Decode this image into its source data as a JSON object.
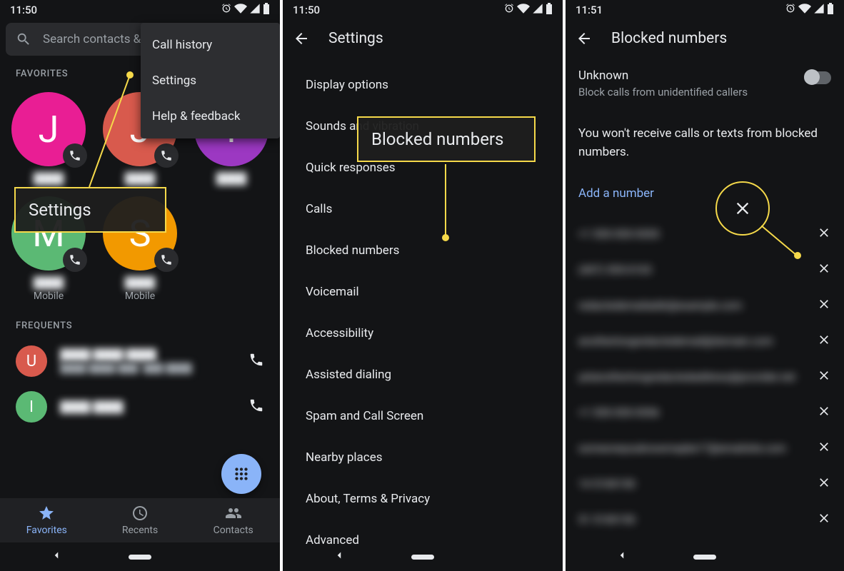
{
  "status": {
    "time_a": "11:50",
    "time_b": "11:50",
    "time_c": "11:51"
  },
  "pane1": {
    "search_placeholder": "Search contacts & places",
    "menu": [
      "Call history",
      "Settings",
      "Help & feedback"
    ],
    "section_favorites": "FAVORITES",
    "section_frequents": "FREQUENTS",
    "favorites": [
      {
        "letter": "J",
        "color": "#e91e94",
        "name": "████",
        "sub": ""
      },
      {
        "letter": "J",
        "color": "#d85a4d",
        "name": "████",
        "sub": ""
      },
      {
        "letter": "Y",
        "color": "#9c38c2",
        "name": "████",
        "sub": ""
      },
      {
        "letter": "M",
        "color": "#5bb974",
        "name": "████",
        "sub": "Mobile"
      },
      {
        "letter": "S",
        "color": "#f29900",
        "name": "████",
        "sub": "Mobile"
      }
    ],
    "frequents": [
      {
        "letter": "U",
        "color": "#d85a4d",
        "line1": "████ ████ ████",
        "line2": "████ ████(███) ███-████"
      },
      {
        "letter": "I",
        "color": "#5bb974",
        "line1": "████ ████",
        "line2": "████(███) ███-████"
      }
    ],
    "tabs": [
      "Favorites",
      "Recents",
      "Contacts"
    ],
    "callout_label": "Settings"
  },
  "pane2": {
    "header": "Settings",
    "items": [
      "Display options",
      "Sounds and vibration",
      "Quick responses",
      "Calls",
      "Blocked numbers",
      "Voicemail",
      "Accessibility",
      "Assisted dialing",
      "Spam and Call Screen",
      "Nearby places",
      "About, Terms & Privacy",
      "Advanced"
    ],
    "callout_label": "Blocked numbers"
  },
  "pane3": {
    "header": "Blocked numbers",
    "unknown_title": "Unknown",
    "unknown_desc": "Block calls from unidentified callers",
    "info": "You won't receive calls or texts from blocked numbers.",
    "add_label": "Add a number",
    "blocked": [
      "+1 555-555-5555",
      "(407) 555-0103",
      "redactedemailaddr@example.com",
      "anotherlongredactedemail@domain.com",
      "yetanotherlongredactedaddress@provider.net",
      "+1 555-555-5556",
      "someoneyouknowmaybe17@emailsite.com",
      "14 5100150",
      "51 5100150"
    ]
  }
}
